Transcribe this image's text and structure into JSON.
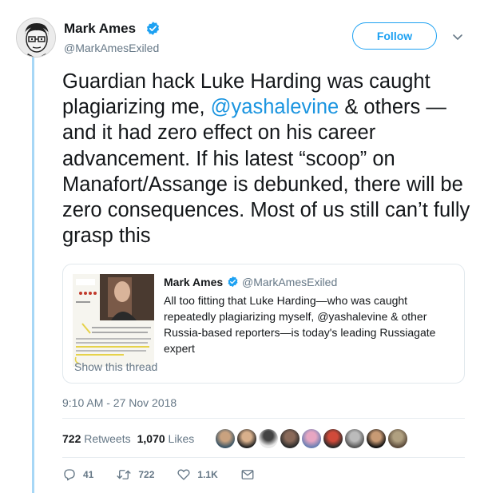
{
  "author": {
    "name": "Mark Ames",
    "handle": "@MarkAmesExiled"
  },
  "follow_label": "Follow",
  "tweet": {
    "text_part1": "Guardian hack Luke Harding was caught plagiarizing me, ",
    "mention": "@yashalevine",
    "text_part2": " & others —and it had zero effect on his career advancement. If his latest “scoop” on Manafort/Assange is debunked, there will be zero consequences. Most of us still can’t fully grasp this"
  },
  "quote": {
    "name": "Mark Ames",
    "handle": "@MarkAmesExiled",
    "text": "All too fitting that Luke Harding—who was caught repeatedly plagiarizing myself, @yashalevine & other Russia-based reporters—is today's leading Russiagate expert",
    "show_thread": "Show this thread"
  },
  "timestamp": "9:10 AM - 27 Nov 2018",
  "stats": {
    "retweets_count": "722",
    "retweets_label": "Retweets",
    "likes_count": "1,070",
    "likes_label": "Likes"
  },
  "actions": {
    "reply_count": "41",
    "retweet_count": "722",
    "like_count": "1.1K"
  },
  "colors": {
    "accent": "#1da1f2",
    "mention": "#1b95e0",
    "secondary_text": "#657786",
    "thread_line": "#a7d7f6"
  },
  "icons": [
    "verified-badge-icon",
    "chevron-down-icon",
    "reply-icon",
    "retweet-icon",
    "like-icon",
    "direct-message-icon"
  ]
}
